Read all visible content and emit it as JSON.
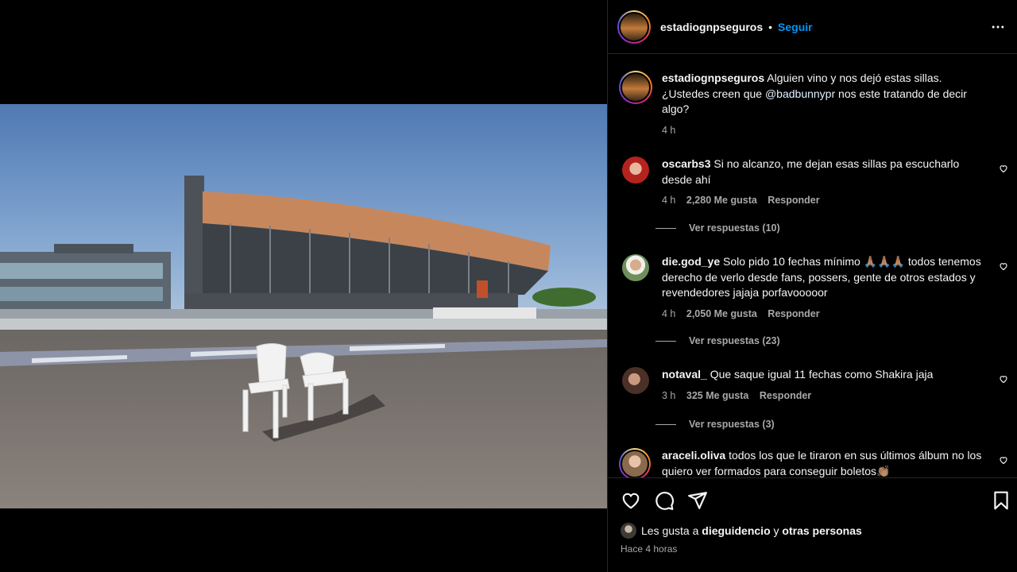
{
  "post": {
    "account": "estadiognpseguros",
    "separator": "•",
    "follow_label": "Seguir",
    "more_icon": "more-horizontal-icon"
  },
  "caption": {
    "user": "estadiognpseguros",
    "text_1": "Alguien vino y nos dejó estas sillas. ¿Ustedes creen que",
    "mention": "@badbunnypr",
    "text_2": "nos este tratando de decir algo?",
    "time": "4 h"
  },
  "comments": [
    {
      "user": "oscarbs3",
      "text": "Si no alcanzo, me dejan esas sillas pa escucharlo desde ahí",
      "time": "4 h",
      "likes": "2,280 Me gusta",
      "reply": "Responder",
      "view_replies": "Ver respuestas (10)"
    },
    {
      "user": "die.god_ye",
      "text": "Solo pido 10 fechas mínimo 🙏🏽🙏🏽🙏🏽 todos tenemos derecho de verlo desde fans, possers, gente de otros estados y revendedores jajaja porfavooooor",
      "time": "4 h",
      "likes": "2,050 Me gusta",
      "reply": "Responder",
      "view_replies": "Ver respuestas (23)"
    },
    {
      "user": "notaval_",
      "text": "Que saque igual 11 fechas como Shakira jaja",
      "time": "3 h",
      "likes": "325 Me gusta",
      "reply": "Responder",
      "view_replies": "Ver respuestas (3)"
    },
    {
      "user": "araceli.oliva",
      "text": "todos los que le tiraron en sus últimos álbum no los quiero ver formados para conseguir boletos👏🏽"
    }
  ],
  "likes": {
    "prefix": "Les gusta a",
    "user": "dieguidencio",
    "conj": "y",
    "others": "otras personas"
  },
  "posted": "Hace 4 horas",
  "colors": {
    "accent": "#0095f6",
    "muted": "#a8a8a8",
    "background": "#000000",
    "divider": "#262626"
  }
}
